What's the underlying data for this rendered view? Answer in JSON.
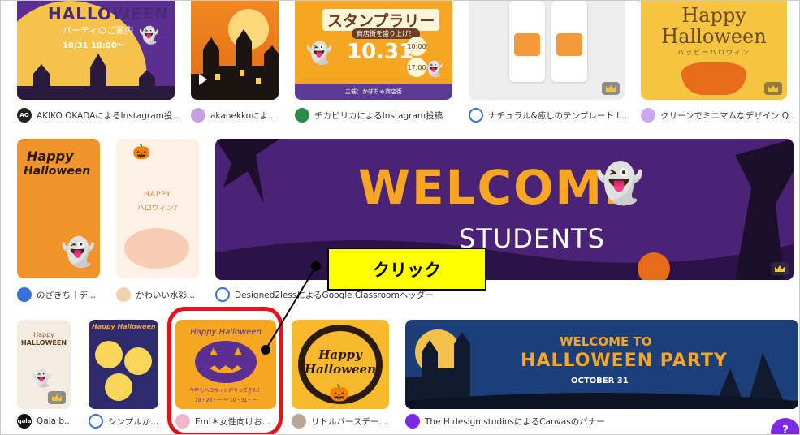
{
  "rows": {
    "row1": {
      "tiles": [
        {
          "text_lines": [
            "HALLOWEEN",
            "パーティのご案内",
            "10/31 18:00〜"
          ]
        },
        {
          "text_lines": []
        },
        {
          "text_lines": [
            "スタンプラリー",
            "商店街を盛り上げ！",
            "10.31",
            "10:00",
            "17:00",
            "主催：かぼちゃ商店街"
          ]
        },
        {
          "text_lines": []
        },
        {
          "text_lines": [
            "Happy",
            "Halloween",
            "ハッピーハロウィン"
          ]
        }
      ],
      "authors": [
        {
          "avatar_text": "AO",
          "label": "AKIKO OKADAによるInstagram投..."
        },
        {
          "avatar_text": "",
          "label": "akanekkoによ..."
        },
        {
          "avatar_text": "",
          "label": "チカピリカによるInstagram投稿"
        },
        {
          "avatar_text": "",
          "label": "ナチュラル&癒しのテンプレート l..."
        },
        {
          "avatar_text": "",
          "label": "クリーンでミニマムなデザイン Q..."
        }
      ]
    },
    "row2": {
      "tiles": [
        {
          "text_lines": [
            "Happy",
            "Halloween"
          ]
        },
        {
          "text_lines": [
            "HAPPY",
            "ハロウィン♪"
          ]
        },
        {
          "text_lines": [
            "WELCOME",
            "STUDENTS"
          ]
        }
      ],
      "authors": [
        {
          "avatar_text": "",
          "label": "のざきち｜デ..."
        },
        {
          "avatar_text": "",
          "label": "かわいい水彩..."
        },
        {
          "avatar_text": "",
          "label": "Designed2lessによるGoogle Classroomヘッダー"
        }
      ]
    },
    "row3": {
      "tiles": [
        {
          "text_lines": [
            "Happy",
            "HALLOWEEN"
          ]
        },
        {
          "text_lines": [
            "Happy Halloween"
          ]
        },
        {
          "text_lines": [
            "Happy Halloween",
            "今年もハロウィンがやってきた！",
            "10・20・ー ～ 10・31・ー"
          ]
        },
        {
          "text_lines": [
            "Happy",
            "Halloween"
          ]
        },
        {
          "text_lines": [
            "WELCOME TO",
            "HALLOWEEN PARTY",
            "OCTOBER 31"
          ]
        }
      ],
      "authors": [
        {
          "avatar_text": "qala",
          "label": "Qala b..."
        },
        {
          "avatar_text": "",
          "label": "シンプルか..."
        },
        {
          "avatar_text": "",
          "label": "Emi＊女性向けお..."
        },
        {
          "avatar_text": "",
          "label": "リトルバースデー..."
        },
        {
          "avatar_text": "",
          "label": "The H design studiosによるCanvasのバナー"
        }
      ]
    }
  },
  "annotation": {
    "label": "クリック"
  },
  "help_button": {
    "label": "?"
  },
  "colors": {
    "highlight": "#e3131b",
    "callout": "#ffff00",
    "help": "#7d2ae8",
    "crown": "#f4c23a"
  }
}
